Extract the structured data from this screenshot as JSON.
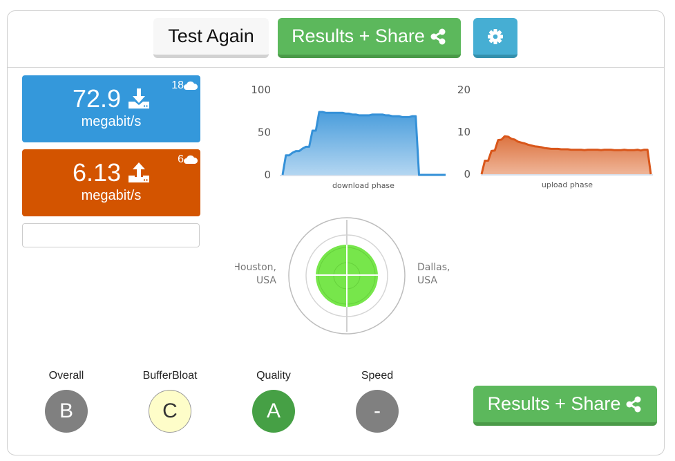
{
  "toolbar": {
    "test_again_label": "Test Again",
    "results_share_label": "Results + Share",
    "settings_icon": "gear-icon",
    "share_icon": "share-icon"
  },
  "download": {
    "value": "72.9",
    "unit": "megabit/s",
    "servers": "18",
    "icon": "download-icon",
    "color": "#3498db"
  },
  "upload": {
    "value": "6.13",
    "unit": "megabit/s",
    "servers": "6",
    "icon": "upload-icon",
    "color": "#d35400"
  },
  "chart_data": [
    {
      "type": "area",
      "title": "",
      "xlabel": "download phase",
      "ylabel": "",
      "ylim": [
        0,
        100
      ],
      "yticks": [
        "0",
        "50",
        "100"
      ],
      "grid": false,
      "color": "#3498db",
      "values": [
        0,
        23,
        23,
        26,
        28,
        28,
        31,
        33,
        33,
        52,
        52,
        74,
        74,
        73,
        73,
        73,
        73,
        73,
        73,
        72,
        72,
        71,
        71,
        70,
        70,
        70,
        70,
        71,
        71,
        71,
        71,
        70,
        70,
        69,
        69,
        69,
        68,
        68,
        68,
        69,
        69,
        0,
        0,
        0,
        0,
        0,
        0,
        0,
        0,
        0
      ]
    },
    {
      "type": "area",
      "title": "",
      "xlabel": "upload phase",
      "ylabel": "",
      "ylim": [
        0,
        20
      ],
      "yticks": [
        "0",
        "10",
        "20"
      ],
      "grid": false,
      "color": "#d35400",
      "values": [
        0,
        3.2,
        3.2,
        5.5,
        5.6,
        8.1,
        8.2,
        9.0,
        8.9,
        8.4,
        8.2,
        7.7,
        7.5,
        7.3,
        7.0,
        6.8,
        6.6,
        6.5,
        6.4,
        6.2,
        6.1,
        6.0,
        6.0,
        6.0,
        5.9,
        5.9,
        5.9,
        5.8,
        5.8,
        5.8,
        5.8,
        5.7,
        5.8,
        5.8,
        5.8,
        5.8,
        5.7,
        5.8,
        5.8,
        5.8,
        5.7,
        5.7,
        5.7,
        5.8,
        5.7,
        5.7,
        5.7,
        5.8,
        5.6,
        5.8,
        5.8,
        0
      ]
    }
  ],
  "servers_map": {
    "left_location_line1": "Houston,",
    "left_location_line2": "USA",
    "right_location_line1": "Dallas,",
    "right_location_line2": "USA",
    "indicator_color": "#77e64b"
  },
  "grades": [
    {
      "label": "Overall",
      "grade": "B",
      "bg": "#808080",
      "fg": "#ffffff"
    },
    {
      "label": "BufferBloat",
      "grade": "C",
      "bg": "#fefdc9",
      "fg": "#333333"
    },
    {
      "label": "Quality",
      "grade": "A",
      "bg": "#46a045",
      "fg": "#ffffff"
    },
    {
      "label": "Speed",
      "grade": "-",
      "bg": "#808080",
      "fg": "#ffffff"
    }
  ]
}
